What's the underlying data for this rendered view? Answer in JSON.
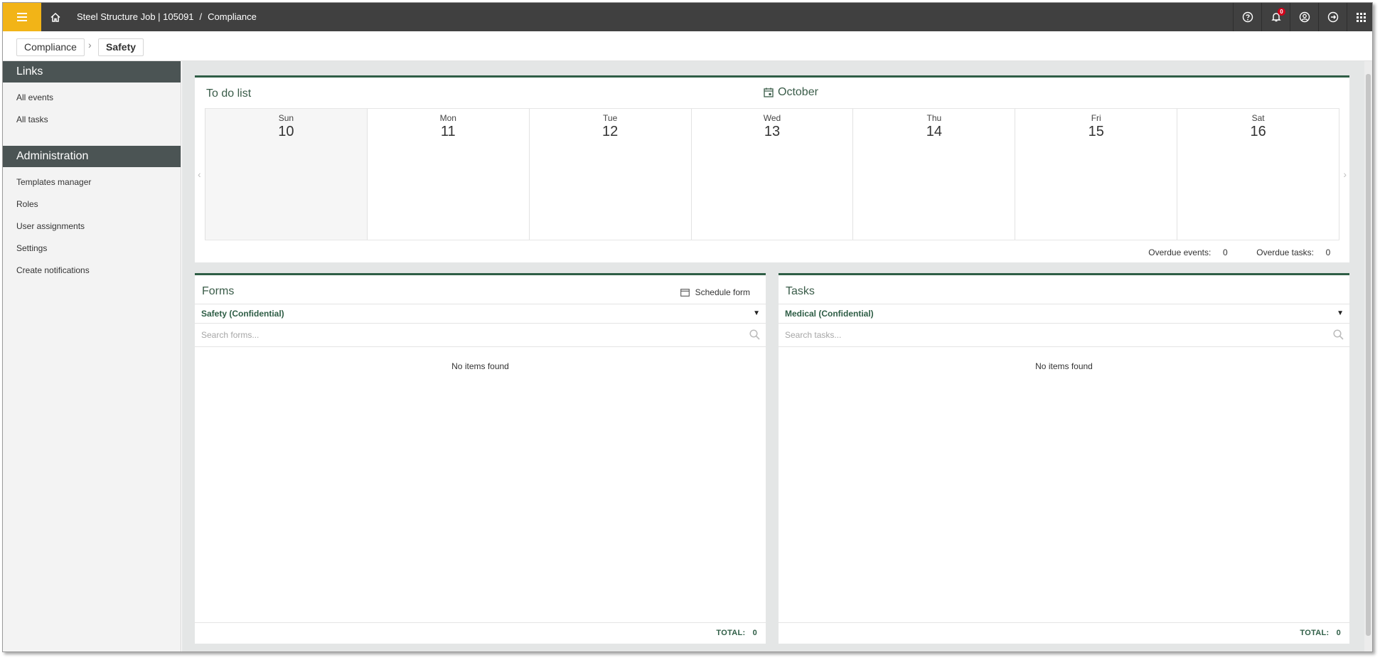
{
  "topbar": {
    "project": "Steel Structure Job | 105091",
    "separator": "/",
    "section": "Compliance",
    "notification_count": "0",
    "icons": [
      "menu-icon",
      "home-icon",
      "help-icon",
      "bell-icon",
      "user-icon",
      "logout-icon",
      "apps-grid-icon"
    ],
    "accent_color": "#f2b417",
    "bar_color": "#404040"
  },
  "breadcrumb": {
    "items": [
      "Compliance",
      "Safety"
    ]
  },
  "sidebar": {
    "links_heading": "Links",
    "links": [
      "All events",
      "All tasks"
    ],
    "admin_heading": "Administration",
    "admin_items": [
      "Templates manager",
      "Roles",
      "User assignments",
      "Settings",
      "Create notifications"
    ]
  },
  "todo": {
    "title": "To do list",
    "month": "October",
    "days": [
      {
        "name": "Sun",
        "num": "10"
      },
      {
        "name": "Mon",
        "num": "11"
      },
      {
        "name": "Tue",
        "num": "12"
      },
      {
        "name": "Wed",
        "num": "13"
      },
      {
        "name": "Thu",
        "num": "14"
      },
      {
        "name": "Fri",
        "num": "15"
      },
      {
        "name": "Sat",
        "num": "16"
      }
    ],
    "overdue_events_label": "Overdue events:",
    "overdue_events": "0",
    "overdue_tasks_label": "Overdue tasks:",
    "overdue_tasks": "0"
  },
  "forms": {
    "title": "Forms",
    "schedule_label": "Schedule form",
    "dropdown": "Safety (Confidential)",
    "search_placeholder": "Search forms...",
    "empty": "No items found",
    "total_label": "TOTAL:",
    "total": "0"
  },
  "tasks": {
    "title": "Tasks",
    "dropdown": "Medical (Confidential)",
    "search_placeholder": "Search tasks...",
    "empty": "No items found",
    "total_label": "TOTAL:",
    "total": "0"
  },
  "theme": {
    "green": "#2f5e46",
    "sidebar_head": "#4b5454"
  }
}
